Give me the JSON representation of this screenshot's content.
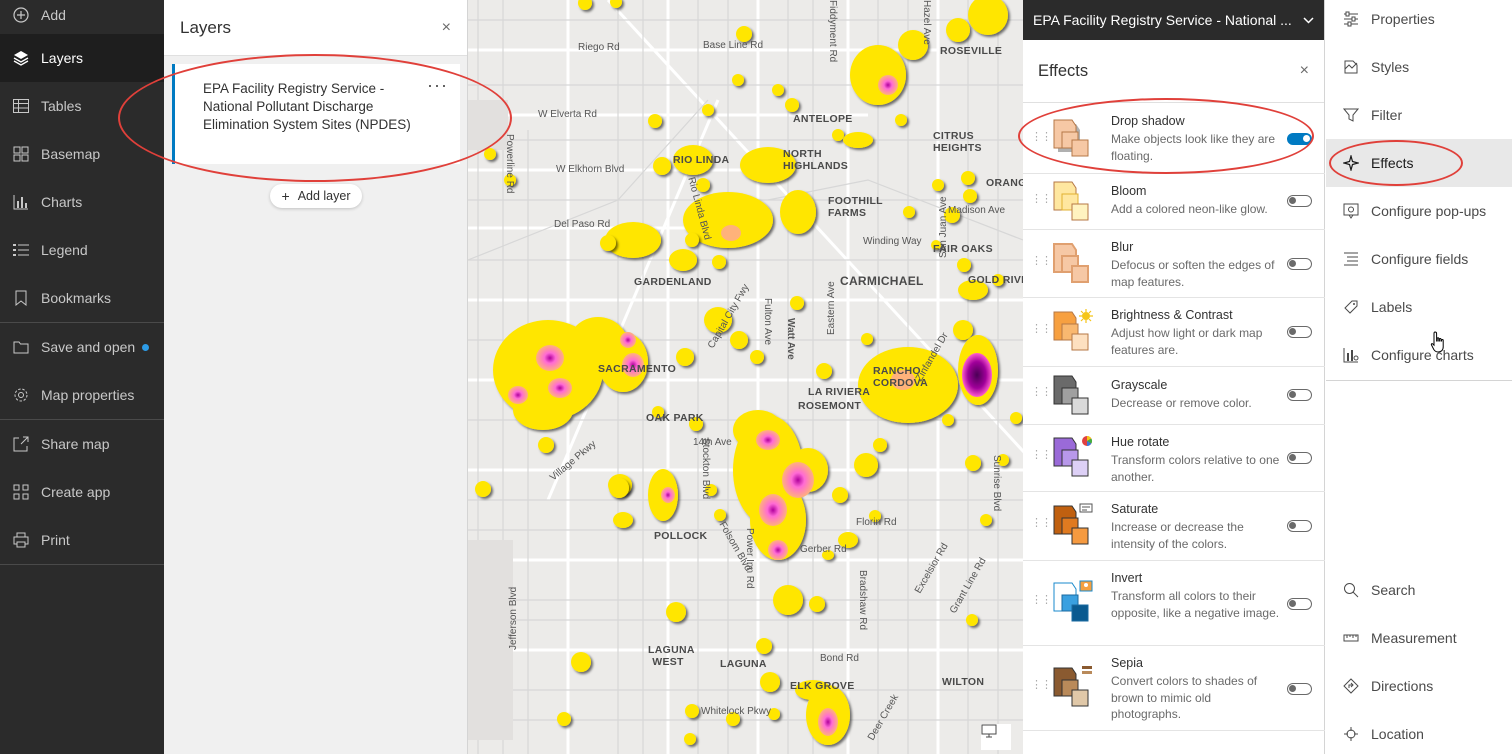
{
  "nav": {
    "items": [
      {
        "label": "Add",
        "icon": "add-icon"
      },
      {
        "label": "Layers",
        "icon": "layers-icon",
        "active": true
      },
      {
        "label": "Tables",
        "icon": "table-icon"
      },
      {
        "label": "Basemap",
        "icon": "basemap-icon"
      },
      {
        "label": "Charts",
        "icon": "chart-icon"
      },
      {
        "label": "Legend",
        "icon": "legend-icon"
      },
      {
        "label": "Bookmarks",
        "icon": "bookmark-icon"
      },
      {
        "label": "Save and open",
        "icon": "folder-icon",
        "badge_color": "#2d9be6"
      },
      {
        "label": "Map properties",
        "icon": "gear-icon"
      },
      {
        "label": "Share map",
        "icon": "share-icon"
      },
      {
        "label": "Create app",
        "icon": "apps-icon"
      },
      {
        "label": "Print",
        "icon": "print-icon"
      }
    ]
  },
  "layers_panel": {
    "title": "Layers",
    "close": "×",
    "layer_title": "EPA Facility Registry Service - National Pollutant Discharge Elimination System Sites (NPDES)",
    "more": "···",
    "add_layer": "Add layer",
    "add_plus": "+"
  },
  "map": {
    "labels": [
      {
        "text": "Riego Rd",
        "type": "road"
      },
      {
        "text": "Base Line Rd",
        "type": "road"
      },
      {
        "text": "W Elverta Rd",
        "type": "road"
      },
      {
        "text": "ANTELOPE",
        "type": "city"
      },
      {
        "text": "W Elkhorn Blvd",
        "type": "road"
      },
      {
        "text": "RIO LINDA",
        "type": "city"
      },
      {
        "text": "NORTH HIGHLANDS",
        "type": "city"
      },
      {
        "text": "CITRUS HEIGHTS",
        "type": "city"
      },
      {
        "text": "ORANGEVALE",
        "type": "city"
      },
      {
        "text": "Del Paso Rd",
        "type": "road"
      },
      {
        "text": "FOOTHILL FARMS",
        "type": "city"
      },
      {
        "text": "Madison Ave",
        "type": "road"
      },
      {
        "text": "FAIR OAKS",
        "type": "city"
      },
      {
        "text": "Winding Way",
        "type": "road"
      },
      {
        "text": "GARDENLAND",
        "type": "city"
      },
      {
        "text": "CARMICHAEL",
        "type": "city"
      },
      {
        "text": "GOLD RIVER",
        "type": "city"
      },
      {
        "text": "SACRAMENTO",
        "type": "city"
      },
      {
        "text": "RANCHO CORDOVA",
        "type": "city"
      },
      {
        "text": "LA RIVIERA",
        "type": "city"
      },
      {
        "text": "ROSEMONT",
        "type": "city"
      },
      {
        "text": "OAK PARK",
        "type": "city"
      },
      {
        "text": "14th Ave",
        "type": "road"
      },
      {
        "text": "Village Pkwy",
        "type": "road"
      },
      {
        "text": "POLLOCK",
        "type": "city"
      },
      {
        "text": "Gerber Rd",
        "type": "road"
      },
      {
        "text": "Florin Rd",
        "type": "road"
      },
      {
        "text": "LAGUNA WEST",
        "type": "city"
      },
      {
        "text": "LAGUNA",
        "type": "city"
      },
      {
        "text": "Bond Rd",
        "type": "road"
      },
      {
        "text": "WILTON",
        "type": "city"
      },
      {
        "text": "ELK GROVE",
        "type": "city"
      },
      {
        "text": "Whitelock Pkwy",
        "type": "road"
      },
      {
        "text": "Sunrise Blvd",
        "type": "road"
      },
      {
        "text": "Grant Line Rd",
        "type": "road"
      },
      {
        "text": "Jefferson Blvd",
        "type": "road"
      },
      {
        "text": "Watt Ave",
        "type": "road"
      },
      {
        "text": "Fulton Ave",
        "type": "road"
      },
      {
        "text": "Capital City Fwy",
        "type": "road"
      },
      {
        "text": "Excelsior Rd",
        "type": "road"
      },
      {
        "text": "Bradshaw Rd",
        "type": "road"
      },
      {
        "text": "Power Inn Rd",
        "type": "road"
      },
      {
        "text": "Stockton Blvd",
        "type": "road"
      },
      {
        "text": "Folsom Blvd",
        "type": "road"
      },
      {
        "text": "Powerline Rd",
        "type": "road"
      },
      {
        "text": "Rio Linda Blvd",
        "type": "road"
      },
      {
        "text": "San Juan Ave",
        "type": "road"
      },
      {
        "text": "Eastern Ave",
        "type": "road"
      },
      {
        "text": "Fiddyment Rd",
        "type": "road"
      },
      {
        "text": "Hazel Ave",
        "type": "road"
      },
      {
        "text": "Deer Creek",
        "type": "road"
      },
      {
        "text": "Zinfandel Dr",
        "type": "road"
      },
      {
        "text": "ROSEVILLE",
        "type": "city"
      }
    ]
  },
  "effects_panel": {
    "layer_name": "EPA Facility Registry Service - National ...",
    "title": "Effects",
    "close": "×",
    "items": [
      {
        "name": "Drop shadow",
        "desc": "Make objects look like they are floating.",
        "enabled": true,
        "icon": "drop-shadow-icon"
      },
      {
        "name": "Bloom",
        "desc": "Add a colored neon-like glow.",
        "enabled": false,
        "icon": "bloom-icon"
      },
      {
        "name": "Blur",
        "desc": "Defocus or soften the edges of map features.",
        "enabled": false,
        "icon": "blur-icon"
      },
      {
        "name": "Brightness & Contrast",
        "desc": "Adjust how light or dark map features are.",
        "enabled": false,
        "icon": "brightness-icon"
      },
      {
        "name": "Grayscale",
        "desc": "Decrease or remove color.",
        "enabled": false,
        "icon": "grayscale-icon"
      },
      {
        "name": "Hue rotate",
        "desc": "Transform colors relative to one another.",
        "enabled": false,
        "icon": "hue-rotate-icon"
      },
      {
        "name": "Saturate",
        "desc": "Increase or decrease the intensity of the colors.",
        "enabled": false,
        "icon": "saturate-icon"
      },
      {
        "name": "Invert",
        "desc": "Transform all colors to their opposite, like a negative image.",
        "enabled": false,
        "icon": "invert-icon"
      },
      {
        "name": "Sepia",
        "desc": "Convert colors to shades of brown to mimic old photographs.",
        "enabled": false,
        "icon": "sepia-icon"
      }
    ]
  },
  "right_toolbar": {
    "items": [
      {
        "label": "Properties",
        "icon": "properties-icon"
      },
      {
        "label": "Styles",
        "icon": "styles-icon"
      },
      {
        "label": "Filter",
        "icon": "filter-icon"
      },
      {
        "label": "Effects",
        "icon": "effects-icon",
        "active": true
      },
      {
        "label": "Configure pop-ups",
        "icon": "popup-icon"
      },
      {
        "label": "Configure fields",
        "icon": "fields-icon"
      },
      {
        "label": "Labels",
        "icon": "labels-icon"
      },
      {
        "label": "Configure charts",
        "icon": "configure-charts-icon"
      }
    ],
    "bottom_items": [
      {
        "label": "Search",
        "icon": "search-icon"
      },
      {
        "label": "Measurement",
        "icon": "measure-icon"
      },
      {
        "label": "Directions",
        "icon": "directions-icon"
      },
      {
        "label": "Location",
        "icon": "location-icon"
      }
    ]
  },
  "colors": {
    "accent": "#007ac2",
    "annotation": "#e0403a",
    "heat_low": "#ffe600",
    "heat_mid": "#ff7ad0",
    "heat_high": "#7a007a"
  }
}
